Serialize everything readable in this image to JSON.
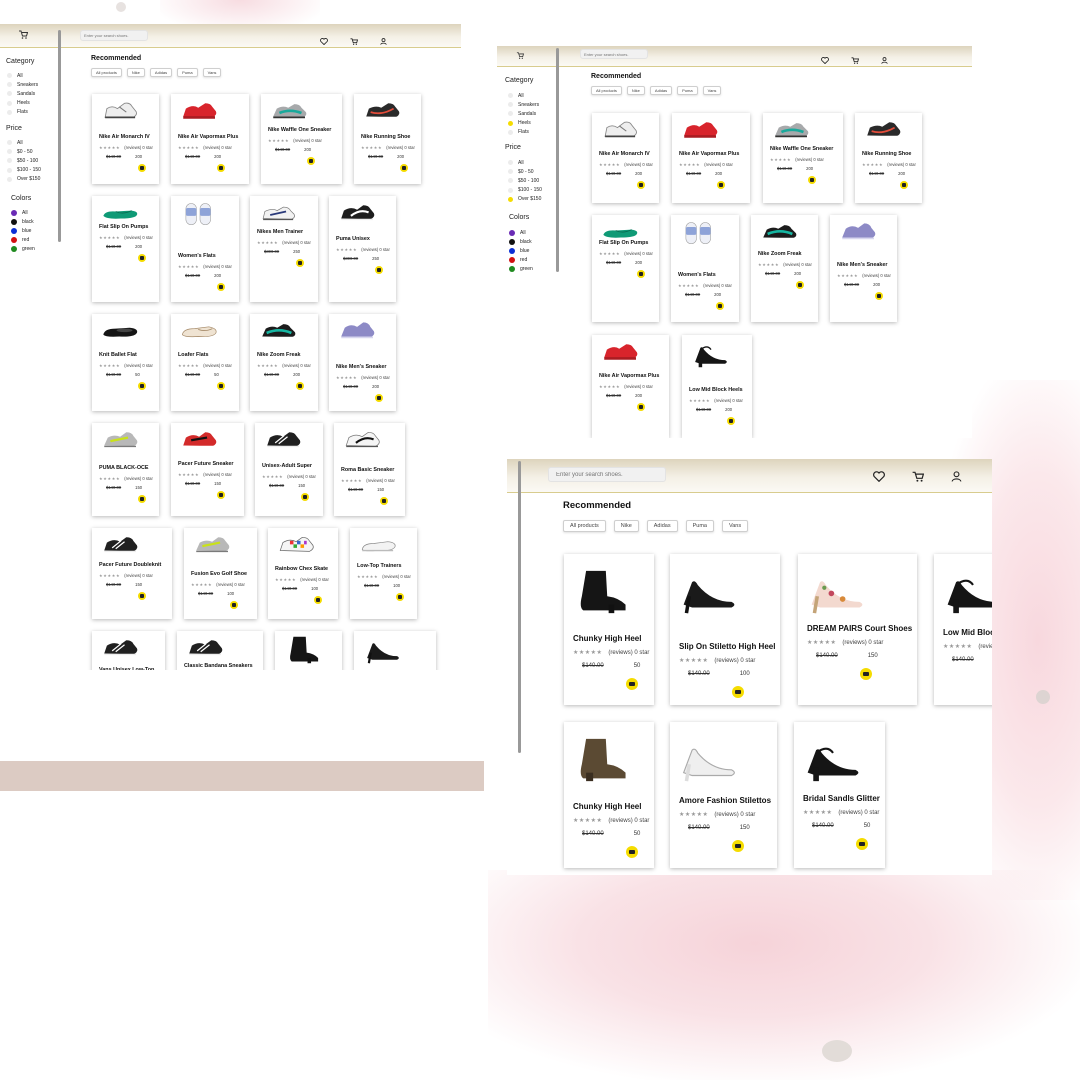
{
  "header": {
    "search_placeholder": "Enter your search shoes."
  },
  "recommended": {
    "title": "Recommended",
    "pills": [
      "All products",
      "Nike",
      "Adidas",
      "Puma",
      "Vans"
    ]
  },
  "sidebar": {
    "category": {
      "title": "Category",
      "items": [
        "All",
        "Sneakers",
        "Sandals",
        "Heels",
        "Flats"
      ]
    },
    "price": {
      "title": "Price",
      "items": [
        "All",
        "$0 - 50",
        "$50 - 100",
        "$100 - 150",
        "Over $150"
      ]
    },
    "colors": {
      "title": "Colors",
      "items": [
        "All",
        "black",
        "blue",
        "red",
        "green"
      ]
    }
  },
  "color_swatches": {
    "all": "#6a2bb5",
    "black": "#111111",
    "blue": "#0b2fd6",
    "red": "#d21111",
    "green": "#1f8a1f"
  },
  "accent_colors": {
    "header_gold": "#d8cc8e",
    "cart_button": "#f5dc00",
    "selected_radio": "#f5dc00"
  },
  "rating_text": "(reviews) 0 star",
  "stars": "★★★★★",
  "screen1": {
    "products": [
      {
        "name": "Nike Air Monarch IV",
        "old_price": "$140.00",
        "new_price": "200"
      },
      {
        "name": "Nike Air Vapormax Plus",
        "old_price": "$140.00",
        "new_price": "200"
      },
      {
        "name": "Nike Waffle One Sneaker",
        "old_price": "$140.00",
        "new_price": "200"
      },
      {
        "name": "Nike Running Shoe",
        "old_price": "$140.00",
        "new_price": "200"
      },
      {
        "name": "Flat Slip On Pumps",
        "old_price": "$140.00",
        "new_price": "200"
      },
      {
        "name": "Women's Flats",
        "old_price": "$140.00",
        "new_price": "200"
      },
      {
        "name": "Nikes Men Trainer",
        "old_price": "$300.00",
        "new_price": "250"
      },
      {
        "name": "Puma Unisex",
        "old_price": "$300.00",
        "new_price": "250"
      },
      {
        "name": "Knit Ballet Flat",
        "old_price": "$140.00",
        "new_price": "50"
      },
      {
        "name": "Loafer Flats",
        "old_price": "$140.00",
        "new_price": "50"
      },
      {
        "name": "Nike Zoom Freak",
        "old_price": "$140.00",
        "new_price": "200"
      },
      {
        "name": "Nike Men's Sneaker",
        "old_price": "$140.00",
        "new_price": "200"
      },
      {
        "name": "PUMA BLACK-OCE",
        "old_price": "$140.00",
        "new_price": "150"
      },
      {
        "name": "Pacer Future Sneaker",
        "old_price": "$140.00",
        "new_price": "150"
      },
      {
        "name": "Unisex-Adult Super",
        "old_price": "$140.00",
        "new_price": "150"
      },
      {
        "name": "Roma Basic Sneaker",
        "old_price": "$140.00",
        "new_price": "150"
      },
      {
        "name": "Pacer Future Doubleknit",
        "old_price": "$140.00",
        "new_price": "150"
      },
      {
        "name": "Fusion Evo Golf Shoe",
        "old_price": "$140.00",
        "new_price": "100"
      },
      {
        "name": "Rainbow Chex Skate",
        "old_price": "$140.00",
        "new_price": "100"
      },
      {
        "name": "Low-Top Trainers",
        "old_price": "$140.00",
        "new_price": "100"
      },
      {
        "name": "Vans Unisex Low-Top",
        "old_price": "",
        "new_price": ""
      },
      {
        "name": "Classic Bandana Sneakers",
        "old_price": "",
        "new_price": ""
      },
      {
        "name": "",
        "old_price": "",
        "new_price": ""
      },
      {
        "name": "",
        "old_price": "",
        "new_price": ""
      }
    ]
  },
  "screen2": {
    "selected_filters": {
      "category": "Heels",
      "price": "Over $150"
    },
    "products": [
      {
        "name": "Nike Air Monarch IV",
        "old_price": "$140.00",
        "new_price": "200"
      },
      {
        "name": "Nike Air Vapormax Plus",
        "old_price": "$140.00",
        "new_price": "200"
      },
      {
        "name": "Nike Waffle One Sneaker",
        "old_price": "$140.00",
        "new_price": "200"
      },
      {
        "name": "Nike Running Shoe",
        "old_price": "$140.00",
        "new_price": "200"
      },
      {
        "name": "Flat Slip On Pumps",
        "old_price": "$140.00",
        "new_price": "200"
      },
      {
        "name": "Women's Flats",
        "old_price": "$140.00",
        "new_price": "200"
      },
      {
        "name": "Nike Zoom Freak",
        "old_price": "$140.00",
        "new_price": "200"
      },
      {
        "name": "Nike Men's Sneaker",
        "old_price": "$140.00",
        "new_price": "200"
      },
      {
        "name": "Nike Air Vapormax Plus",
        "old_price": "$140.00",
        "new_price": "200"
      },
      {
        "name": "Low Mid Block Heels",
        "old_price": "$140.00",
        "new_price": "200"
      }
    ]
  },
  "screen3": {
    "products": [
      {
        "name": "Chunky High Heel",
        "old_price": "$140.00",
        "new_price": "50"
      },
      {
        "name": "Slip On Stiletto High Heel",
        "old_price": "$140.00",
        "new_price": "100"
      },
      {
        "name": "DREAM PAIRS Court Shoes",
        "old_price": "$140.00",
        "new_price": "150"
      },
      {
        "name": "Low Mid Block Heels",
        "old_price": "$140.00",
        "new_price": ""
      },
      {
        "name": "Chunky High Heel",
        "old_price": "$140.00",
        "new_price": "50"
      },
      {
        "name": "Amore Fashion Stilettos",
        "old_price": "$140.00",
        "new_price": "150"
      },
      {
        "name": "Bridal Sandls Glitter",
        "old_price": "$140.00",
        "new_price": "50"
      }
    ]
  }
}
